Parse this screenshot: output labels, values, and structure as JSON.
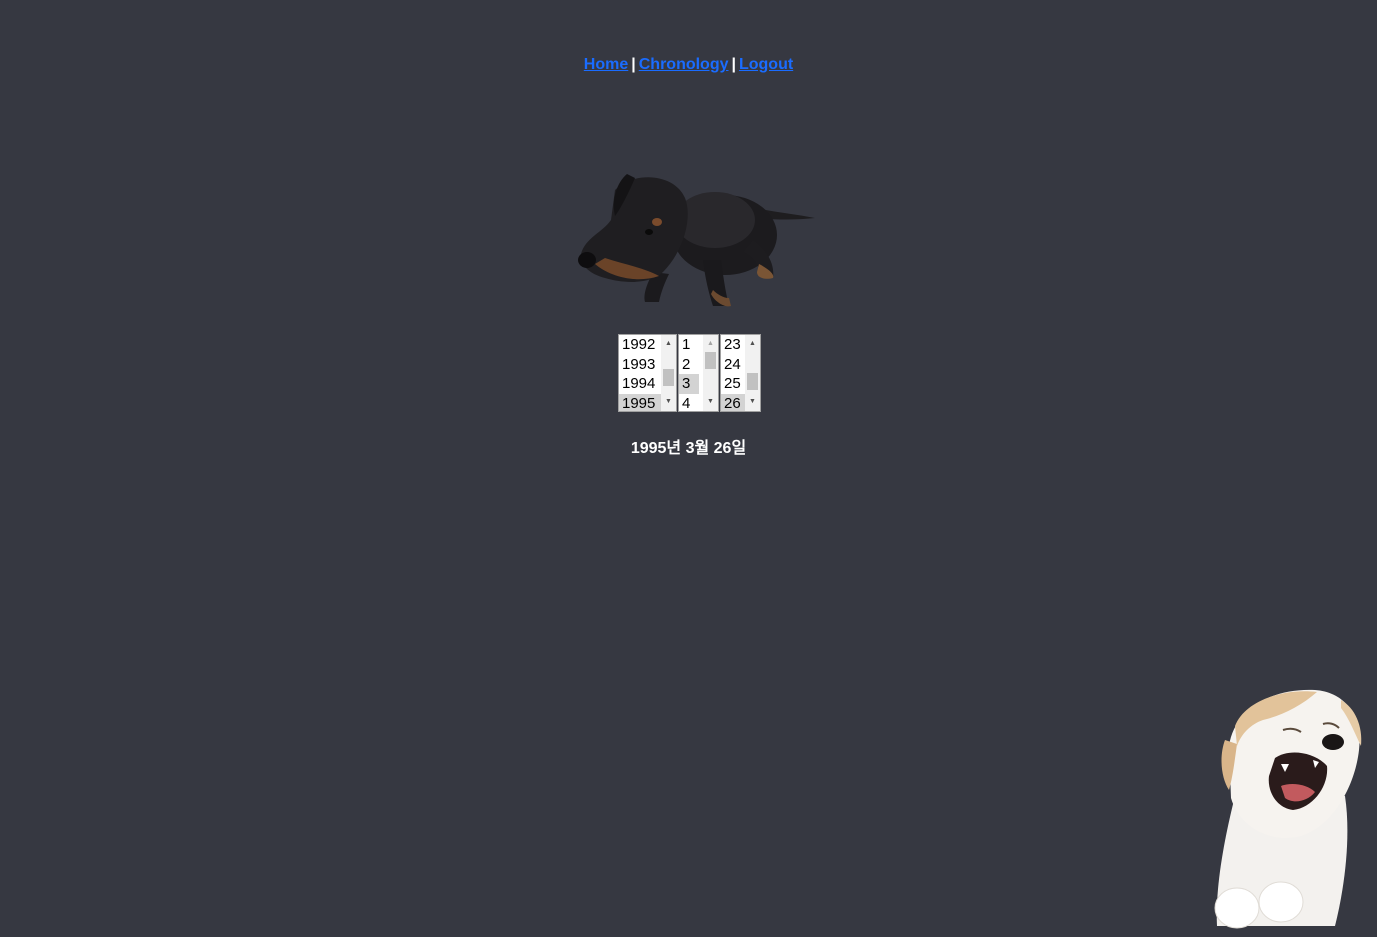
{
  "nav": {
    "home": "Home",
    "chronology": "Chronology",
    "logout": "Logout",
    "separator": "|"
  },
  "selectors": {
    "year": {
      "options": [
        "1992",
        "1993",
        "1994",
        "1995"
      ],
      "selected": "1995"
    },
    "month": {
      "options": [
        "1",
        "2",
        "3",
        "4"
      ],
      "selected": "3"
    },
    "day": {
      "options": [
        "23",
        "24",
        "25",
        "26"
      ],
      "selected": "26"
    }
  },
  "date_display": "1995년 3월 26일",
  "images": {
    "top": "dachshund-puppy-image",
    "bottom": "howling-puppy-image"
  },
  "colors": {
    "background": "#363841",
    "link": "#1a6cff",
    "text": "#ffffff"
  }
}
